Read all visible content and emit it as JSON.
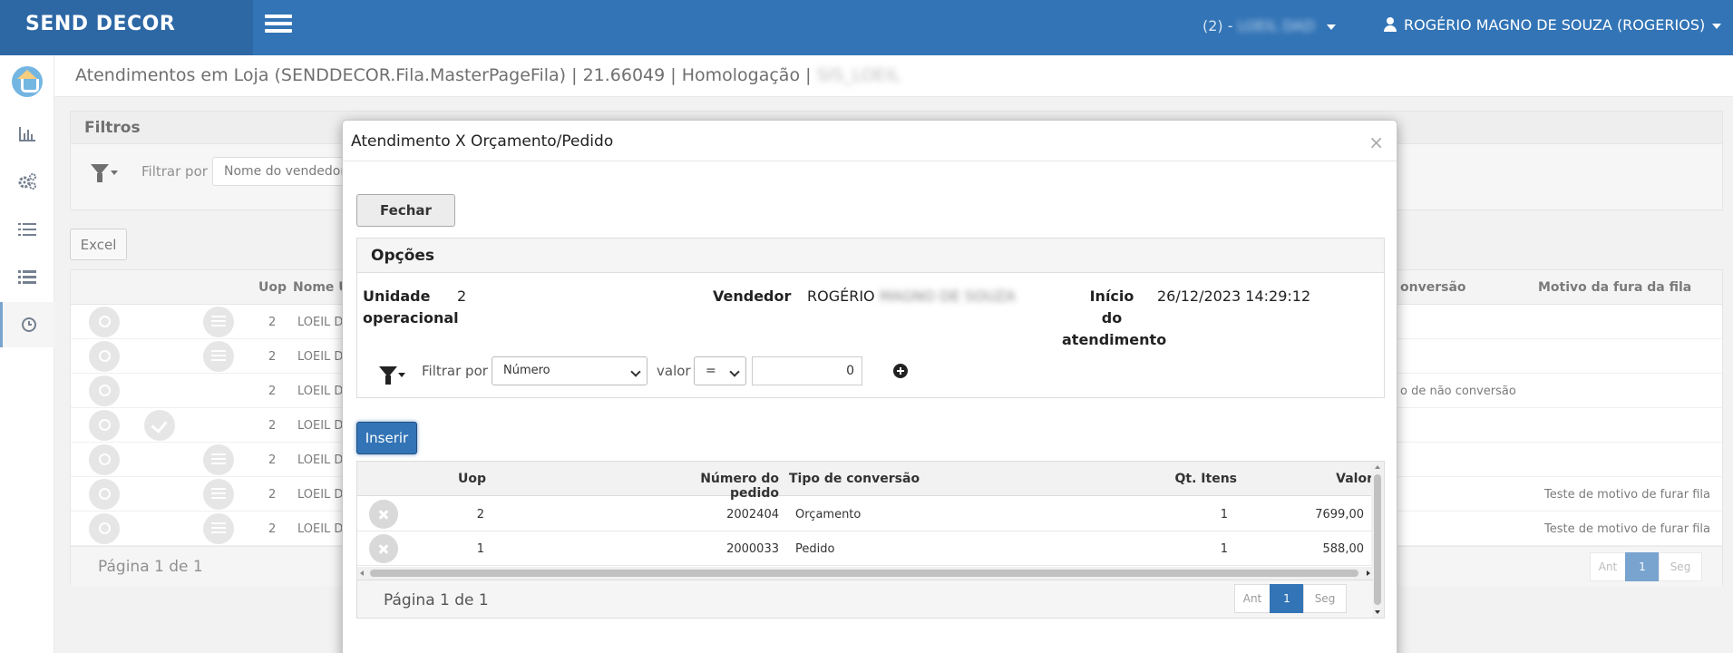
{
  "topbar": {
    "brand": "SEND DECOR",
    "unit_prefix": "(2) -",
    "unit_name": "LOEIL DAD",
    "user": "ROGÉRIO MAGNO DE SOUZA (ROGERIOS)"
  },
  "sidebar": {
    "items": [
      {
        "name": "logo-icon"
      },
      {
        "name": "chart-icon",
        "glyph": "📊"
      },
      {
        "name": "gears-icon",
        "glyph": "⚙"
      },
      {
        "name": "list-ordered-icon",
        "glyph": "☰"
      },
      {
        "name": "list-icon",
        "glyph": "☰"
      },
      {
        "name": "clock-icon",
        "glyph": "◷"
      }
    ]
  },
  "page": {
    "title": "Atendimentos em Loja (SENDDECOR.Fila.MasterPageFila) | 21.66049 | Homologação |",
    "title_env": "SIS_LOEIL"
  },
  "filters": {
    "title": "Filtros",
    "filter_by_label": "Filtrar por",
    "filter_field": "Nome do vendedor"
  },
  "background_table": {
    "excel_label": "Excel",
    "columns": {
      "uop": "Uop",
      "nome": "Nome U",
      "conversao": "onversão",
      "motivo": "Motivo da fura da fila"
    },
    "rows": [
      {
        "uop": "2",
        "nome": "LOEIL DI",
        "conversao": "",
        "motivo": "",
        "icons": [
          "search",
          "list"
        ]
      },
      {
        "uop": "2",
        "nome": "LOEIL DI",
        "conversao": "",
        "motivo": "",
        "icons": [
          "search",
          "list"
        ]
      },
      {
        "uop": "2",
        "nome": "LOEIL DI",
        "conversao": "o de não conversão",
        "motivo": "",
        "icons": [
          "search"
        ]
      },
      {
        "uop": "2",
        "nome": "LOEIL DI",
        "conversao": "",
        "motivo": "",
        "icons": [
          "search",
          "check"
        ]
      },
      {
        "uop": "2",
        "nome": "LOEIL DI",
        "conversao": "",
        "motivo": "",
        "icons": [
          "search",
          "list"
        ]
      },
      {
        "uop": "2",
        "nome": "LOEIL DI",
        "conversao": "",
        "motivo": "Teste de motivo de furar fila",
        "icons": [
          "search",
          "list"
        ]
      },
      {
        "uop": "2",
        "nome": "LOEIL DI",
        "conversao": "",
        "motivo": "Teste de motivo de furar fila",
        "icons": [
          "search",
          "list"
        ]
      }
    ],
    "page_info": "Página 1 de 1",
    "pager": {
      "prev": "Ant",
      "current": "1",
      "next": "Seg"
    }
  },
  "modal": {
    "title": "Atendimento X Orçamento/Pedido",
    "close_glyph": "×",
    "fechar_label": "Fechar",
    "opcoes": {
      "title": "Opções",
      "unidade_label_1": "Unidade",
      "unidade_label_2": "operacional",
      "unidade_value": "2",
      "vendedor_label": "Vendedor",
      "vendedor_first": "ROGÉRIO",
      "vendedor_rest": "MAGNO DE SOUZA",
      "inicio_label_1": "Início",
      "inicio_label_2": "do",
      "inicio_label_3": "atendimento",
      "inicio_value": "26/12/2023 14:29:12",
      "filter_by_label": "Filtrar por",
      "filter_field": "Número",
      "valor_label": "valor",
      "operator": "=",
      "value": "0"
    },
    "inserir_label": "Inserir",
    "grid": {
      "columns": {
        "uop": "Uop",
        "numero": "Número do pedido",
        "tipo": "Tipo de conversão",
        "qt": "Qt. Itens",
        "valor": "Valor"
      },
      "rows": [
        {
          "uop": "2",
          "numero": "2002404",
          "tipo": "Orçamento",
          "qt": "1",
          "valor": "7699,00"
        },
        {
          "uop": "1",
          "numero": "2000033",
          "tipo": "Pedido",
          "qt": "1",
          "valor": "588,00"
        }
      ],
      "page_info": "Página 1 de 1",
      "pager": {
        "prev": "Ant",
        "current": "1",
        "next": "Seg"
      }
    }
  }
}
